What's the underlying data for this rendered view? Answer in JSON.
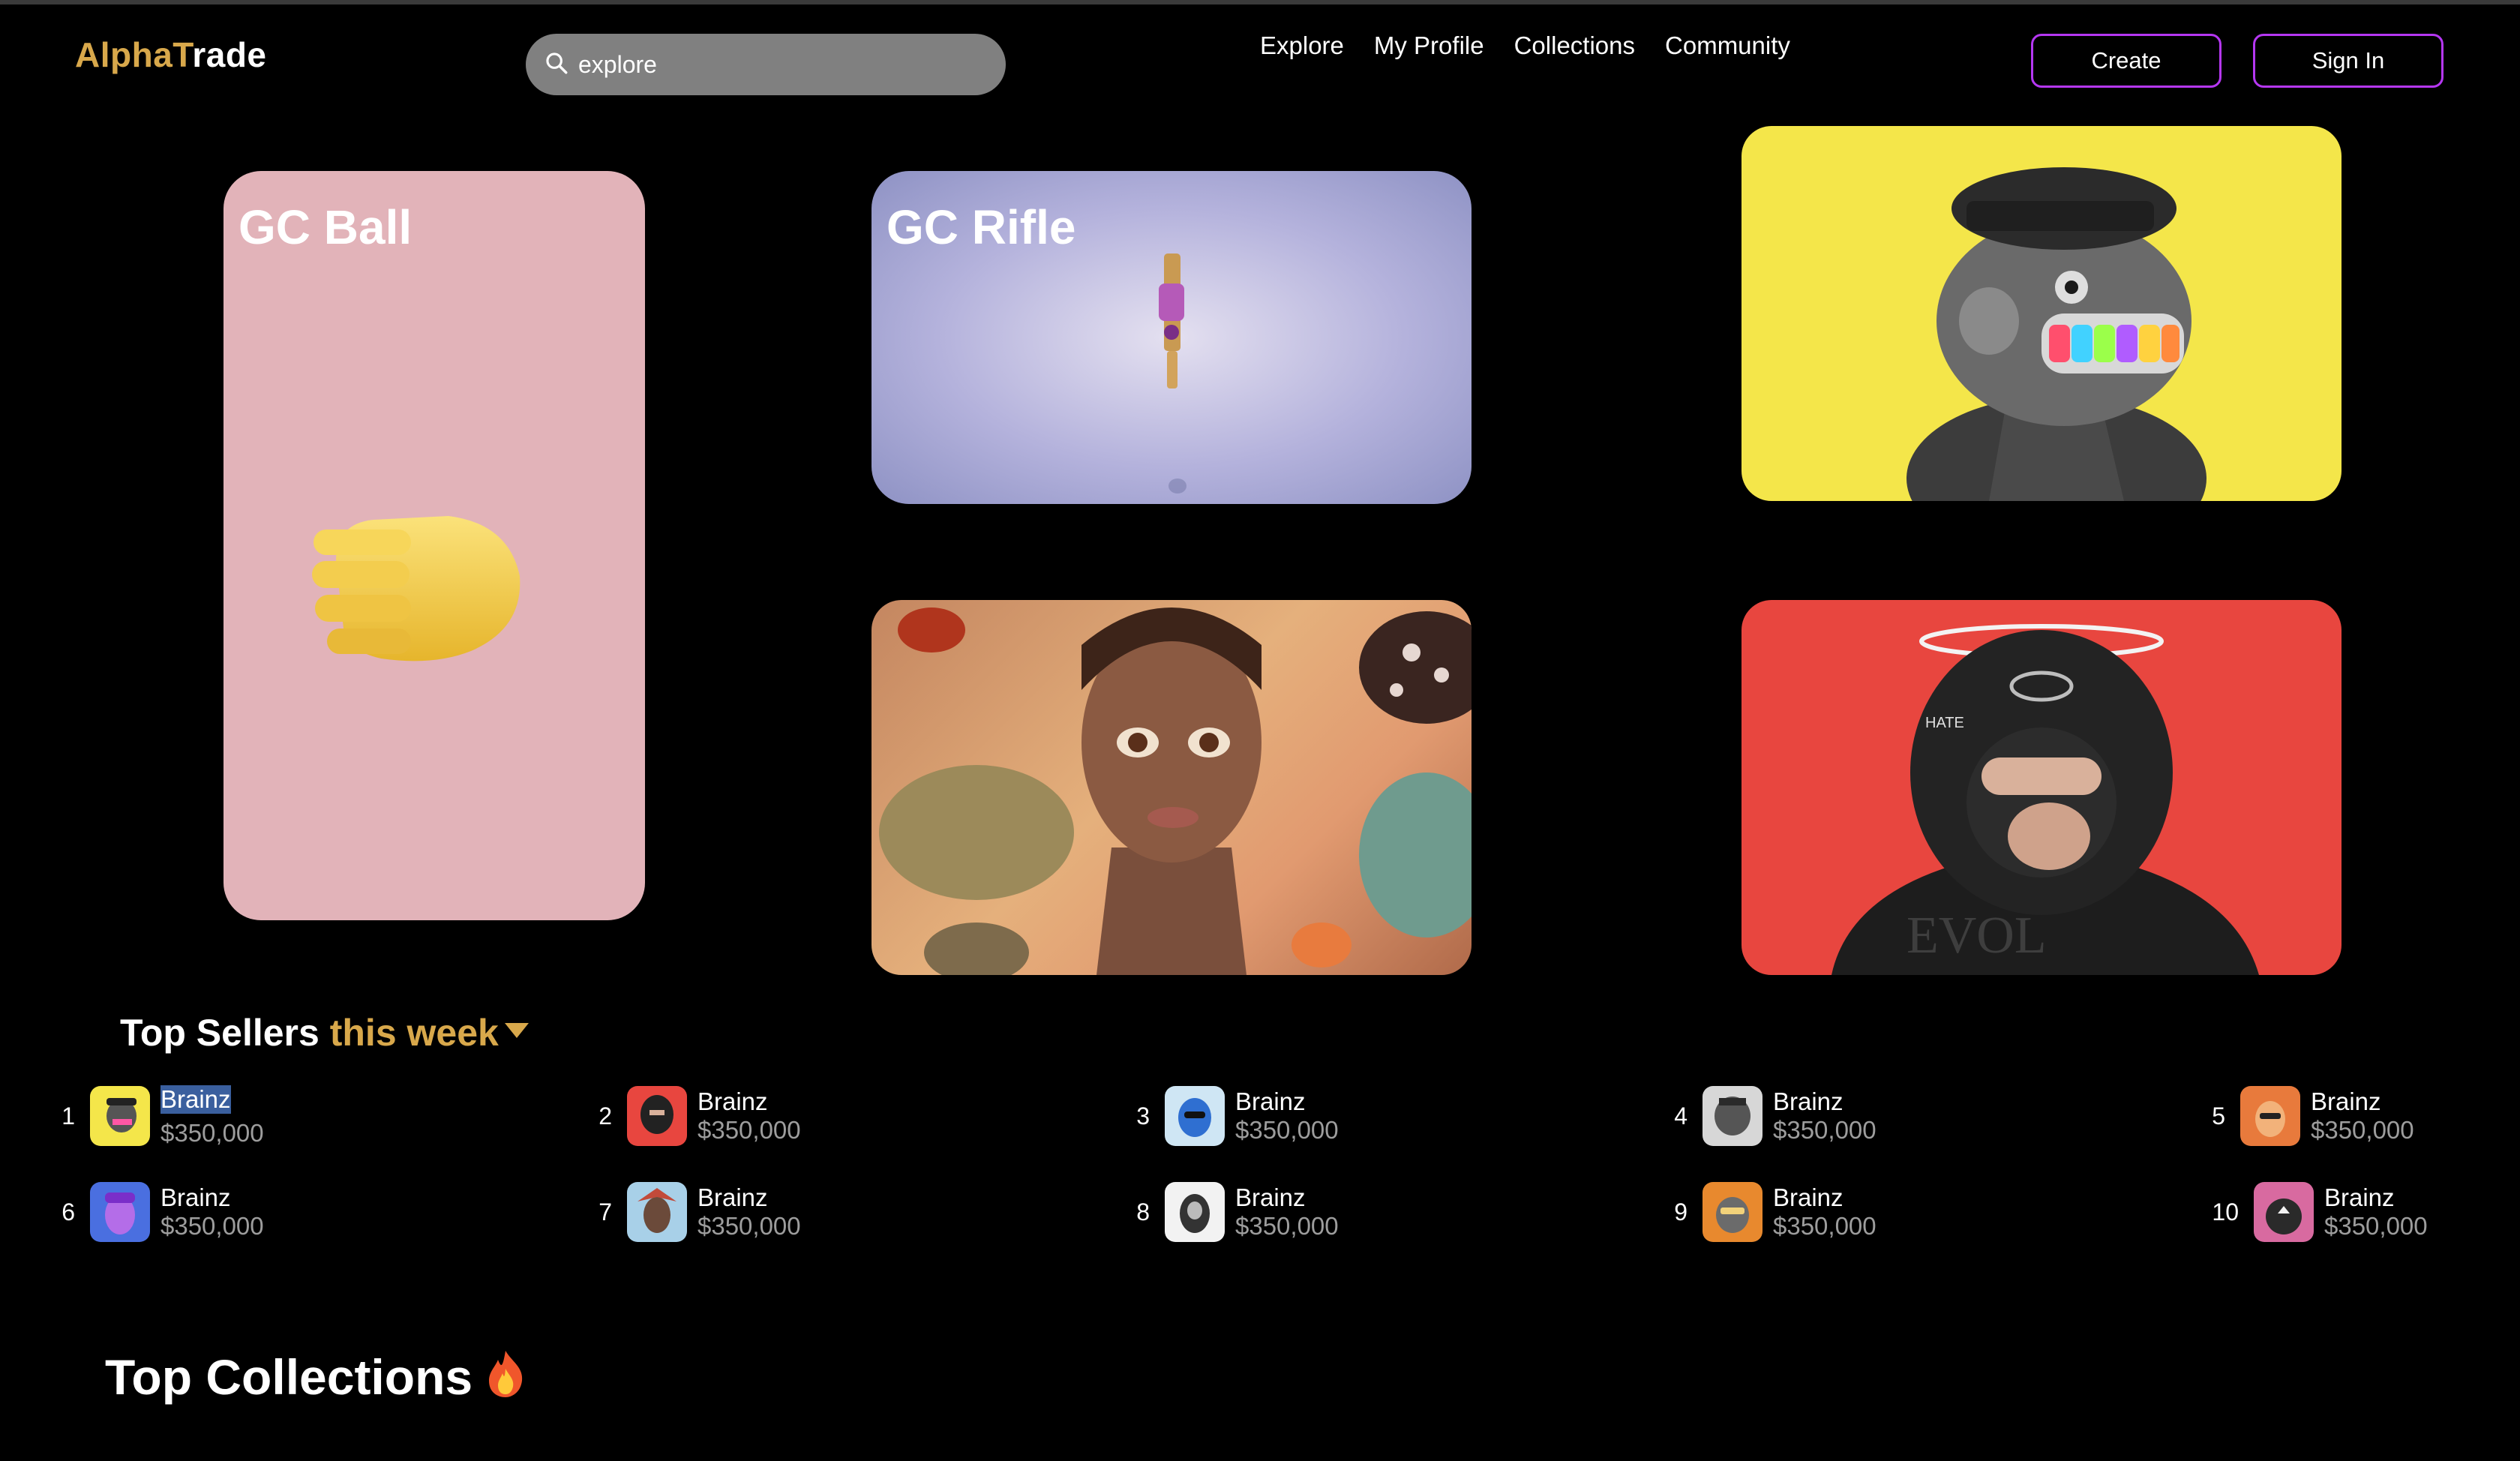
{
  "header": {
    "logo_part1": "Alpha",
    "logo_part2": "T",
    "logo_part3": "rade",
    "search_value": "explore",
    "nav": [
      "Explore",
      "My Profile",
      "Collections",
      "Community"
    ],
    "create_label": "Create",
    "signin_label": "Sign In"
  },
  "cards": {
    "ball_title": "GC Ball",
    "rifle_title": "GC Rifle"
  },
  "top_sellers": {
    "title_main": "Top Sellers",
    "title_accent": "this week",
    "sellers": [
      {
        "rank": "1",
        "name": "Brainz",
        "price": "$350,000"
      },
      {
        "rank": "2",
        "name": "Brainz",
        "price": "$350,000"
      },
      {
        "rank": "3",
        "name": "Brainz",
        "price": "$350,000"
      },
      {
        "rank": "4",
        "name": "Brainz",
        "price": "$350,000"
      },
      {
        "rank": "5",
        "name": "Brainz",
        "price": "$350,000"
      },
      {
        "rank": "6",
        "name": "Brainz",
        "price": "$350,000"
      },
      {
        "rank": "7",
        "name": "Brainz",
        "price": "$350,000"
      },
      {
        "rank": "8",
        "name": "Brainz",
        "price": "$350,000"
      },
      {
        "rank": "9",
        "name": "Brainz",
        "price": "$350,000"
      },
      {
        "rank": "10",
        "name": "Brainz",
        "price": "$350,000"
      }
    ]
  },
  "top_collections": {
    "title": "Top Collections"
  },
  "colors": {
    "accent_gold": "#d8a84b",
    "button_border": "#b537f2",
    "background": "#000000"
  }
}
